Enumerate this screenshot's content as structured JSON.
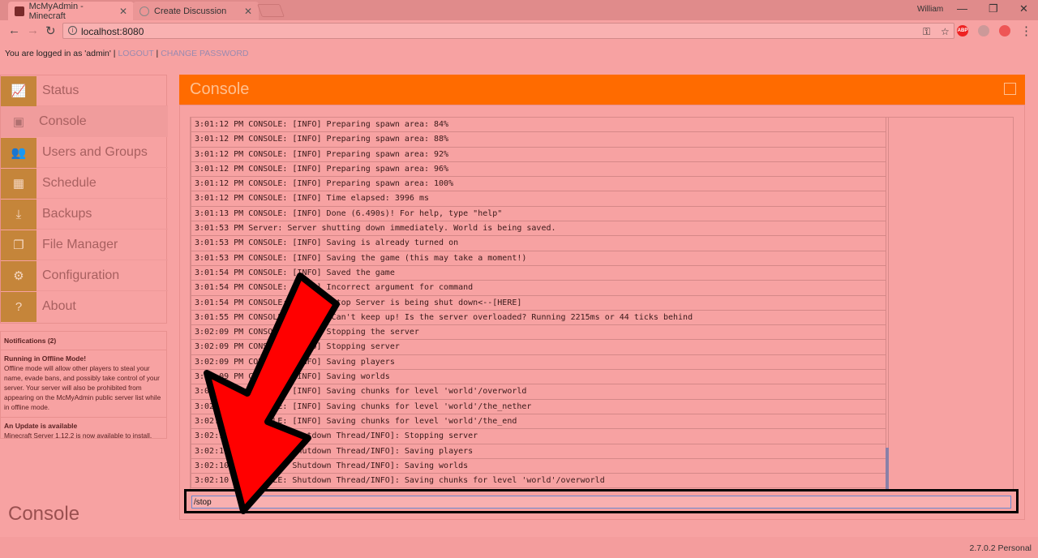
{
  "browser": {
    "tabs": [
      {
        "title": "McMyAdmin - Minecraft",
        "active": true
      },
      {
        "title": "Create Discussion",
        "active": false
      }
    ],
    "user": "William",
    "url": "localhost:8080"
  },
  "login": {
    "text": "You are logged in as 'admin' |",
    "logout": "LOGOUT",
    "sep": "|",
    "change_password": "CHANGE PASSWORD"
  },
  "sidebar": {
    "items": [
      {
        "label": "Status",
        "icon": "chart-icon"
      },
      {
        "label": "Console",
        "icon": "console-icon"
      },
      {
        "label": "Users and Groups",
        "icon": "users-icon"
      },
      {
        "label": "Schedule",
        "icon": "calendar-icon"
      },
      {
        "label": "Backups",
        "icon": "download-icon"
      },
      {
        "label": "File Manager",
        "icon": "files-icon"
      },
      {
        "label": "Configuration",
        "icon": "gear-icon"
      },
      {
        "label": "About",
        "icon": "question-icon"
      }
    ]
  },
  "notifications": {
    "header": "Notifications (2)",
    "items": [
      {
        "title": "Running in Offline Mode!",
        "body": "Offline mode will allow other players to steal your name, evade bans, and possibly take control of your server. Your server will also be prohibited from appearing on the McMyAdmin public server list while in offline mode."
      },
      {
        "title": "An Update is available",
        "body": "Minecraft Server 1.12.2 is now available to install."
      }
    ]
  },
  "page_title": "Console",
  "panel": {
    "title": "Console"
  },
  "console": {
    "lines": [
      "3:01:12 PM CONSOLE: [INFO] Preparing spawn area: 84%",
      "3:01:12 PM CONSOLE: [INFO] Preparing spawn area: 88%",
      "3:01:12 PM CONSOLE: [INFO] Preparing spawn area: 92%",
      "3:01:12 PM CONSOLE: [INFO] Preparing spawn area: 96%",
      "3:01:12 PM CONSOLE: [INFO] Preparing spawn area: 100%",
      "3:01:12 PM CONSOLE: [INFO] Time elapsed: 3996 ms",
      "3:01:13 PM CONSOLE: [INFO] Done (6.490s)! For help, type \"help\"",
      "3:01:53 PM Server: Server shutting down immediately. World is being saved.",
      "3:01:53 PM CONSOLE: [INFO] Saving is already turned on",
      "3:01:53 PM CONSOLE: [INFO] Saving the game (this may take a moment!)",
      "3:01:54 PM CONSOLE: [INFO] Saved the game",
      "3:01:54 PM CONSOLE: [INFO] Incorrect argument for command",
      "3:01:54 PM CONSOLE: [INFO] /stop Server is being shut down<--[HERE]",
      "3:01:55 PM CONSOLE: [WARN]: Can't keep up! Is the server overloaded? Running 2215ms or 44 ticks behind",
      "3:02:09 PM CONSOLE: [INFO] Stopping the server",
      "3:02:09 PM CONSOLE: [INFO] Stopping server",
      "3:02:09 PM CONSOLE: [INFO] Saving players",
      "3:02:09 PM CONSOLE: [INFO] Saving worlds",
      "3:02:09 PM CONSOLE: [INFO] Saving chunks for level 'world'/overworld",
      "3:02:10 PM CONSOLE: [INFO] Saving chunks for level 'world'/the_nether",
      "3:02:10 PM CONSOLE: [INFO] Saving chunks for level 'world'/the_end",
      "3:02:10 PM CONSOLE: Shutdown Thread/INFO]: Stopping server",
      "3:02:10 PM CONSOLE: Shutdown Thread/INFO]: Saving players",
      "3:02:10 PM CONSOLE: Shutdown Thread/INFO]: Saving worlds",
      "3:02:10 PM CONSOLE: Shutdown Thread/INFO]: Saving chunks for level 'world'/overworld"
    ],
    "input_value": "/stop"
  },
  "footer": {
    "version": "2.7.0.2 Personal"
  },
  "colors": {
    "accent": "#ff6b00",
    "arrow": "#ff0000"
  }
}
